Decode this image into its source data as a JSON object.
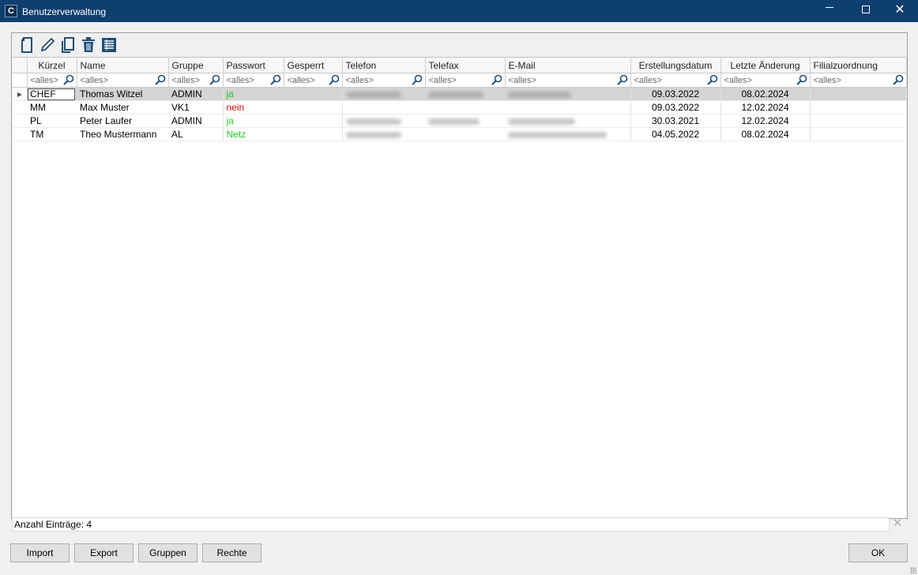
{
  "window": {
    "title": "Benutzerverwaltung",
    "icon": "app-logo-icon"
  },
  "toolbar": {
    "icons": [
      "new-document-icon",
      "edit-pencil-icon",
      "copy-icon",
      "delete-trash-icon",
      "table-list-icon"
    ]
  },
  "grid": {
    "columns": [
      "Kürzel",
      "Name",
      "Gruppe",
      "Passwort",
      "Gesperrt",
      "Telefon",
      "Telefax",
      "E-Mail",
      "Erstellungsdatum",
      "Letzte Änderung",
      "Filialzuordnung"
    ],
    "filter_placeholder": "<alles>",
    "rows": [
      {
        "kuerzel": "CHEF",
        "name": "Thomas Witzel",
        "gruppe": "ADMIN",
        "passwort": "ja",
        "gesperrt": "",
        "erstellt": "09.03.2022",
        "geaendert": "08.02.2024",
        "filiale": ""
      },
      {
        "kuerzel": "MM",
        "name": "Max Muster",
        "gruppe": "VK1",
        "passwort": "nein",
        "gesperrt": "",
        "erstellt": "09.03.2022",
        "geaendert": "12.02.2024",
        "filiale": ""
      },
      {
        "kuerzel": "PL",
        "name": "Peter Laufer",
        "gruppe": "ADMIN",
        "passwort": "ja",
        "gesperrt": "",
        "erstellt": "30.03.2021",
        "geaendert": "12.02.2024",
        "filiale": ""
      },
      {
        "kuerzel": "TM",
        "name": "Theo Mustermann",
        "gruppe": "AL",
        "passwort": "Netz",
        "gesperrt": "",
        "erstellt": "04.05.2022",
        "geaendert": "08.02.2024",
        "filiale": ""
      }
    ]
  },
  "status": {
    "count_text": "Anzahl Einträge: 4"
  },
  "buttons": {
    "import": "Import",
    "export": "Export",
    "gruppen": "Gruppen",
    "rechte": "Rechte",
    "ok": "OK"
  },
  "colors": {
    "titlebar": "#0f3f6f",
    "password_yes": "#22cc22",
    "password_no": "#dd0000",
    "password_netz": "#22cc22",
    "icon_blue": "#1f4e79"
  }
}
